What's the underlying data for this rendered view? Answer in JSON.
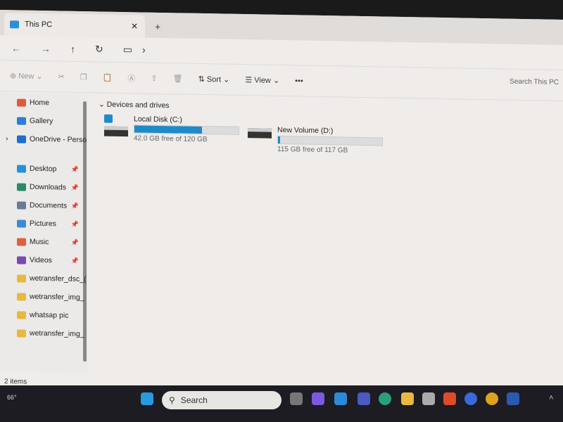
{
  "tab": {
    "title": "This PC",
    "close": "✕",
    "new_tab": "+"
  },
  "nav": {
    "back": "←",
    "forward": "→",
    "up": "↑",
    "refresh": "↻",
    "location_icon": "monitor-icon",
    "chevron": "›"
  },
  "toolbar": {
    "new": "New",
    "sort": "Sort",
    "view": "View",
    "more": "•••",
    "search_placeholder": "Search This PC"
  },
  "sidebar": {
    "items": [
      {
        "label": "Home",
        "icon": "home",
        "color": "#e05a3a"
      },
      {
        "label": "Gallery",
        "icon": "gallery",
        "color": "#2a7fd4"
      },
      {
        "label": "OneDrive - Perso",
        "icon": "cloud",
        "color": "#1a6fd0",
        "expand": "›"
      },
      {
        "label": "Desktop",
        "icon": "desktop",
        "color": "#2a8fd8",
        "pinned": true
      },
      {
        "label": "Downloads",
        "icon": "download",
        "color": "#2a8a6a",
        "pinned": true
      },
      {
        "label": "Documents",
        "icon": "document",
        "color": "#6a7a9a",
        "pinned": true
      },
      {
        "label": "Pictures",
        "icon": "picture",
        "color": "#3a8ad8",
        "pinned": true
      },
      {
        "label": "Music",
        "icon": "music",
        "color": "#e0603a",
        "pinned": true
      },
      {
        "label": "Videos",
        "icon": "video",
        "color": "#7a4ab0",
        "pinned": true
      },
      {
        "label": "wetransfer_dsc_(",
        "icon": "folder",
        "color": "#e8b840"
      },
      {
        "label": "wetransfer_img_",
        "icon": "folder",
        "color": "#e8b840"
      },
      {
        "label": "whatsap pic",
        "icon": "folder",
        "color": "#e8b840"
      },
      {
        "label": "wetransfer_img_",
        "icon": "folder",
        "color": "#e8b840"
      }
    ]
  },
  "main": {
    "group": "Devices and drives",
    "drives": [
      {
        "name": "Local Disk (C:)",
        "free": "42.0 GB free of 120 GB",
        "used_percent": 65
      },
      {
        "name": "New Volume (D:)",
        "free": "115 GB free of 117 GB",
        "used_percent": 2
      }
    ]
  },
  "status": "2 items",
  "taskbar": {
    "weather": "66°",
    "search": "Search"
  }
}
